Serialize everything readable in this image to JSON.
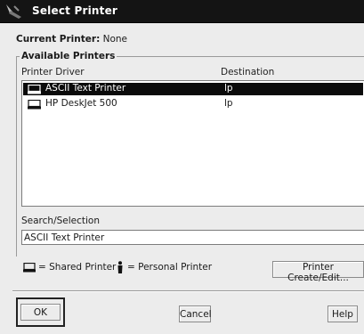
{
  "window": {
    "title": "Select Printer",
    "icon": "printer-icon"
  },
  "current_printer": {
    "label": "Current Printer:",
    "value": "None"
  },
  "available_printers": {
    "legend": "Available Printers",
    "columns": [
      "Printer Driver",
      "Destination"
    ],
    "rows": [
      {
        "name": "ASCII Text Printer",
        "destination": "lp",
        "selected": true,
        "type": "shared"
      },
      {
        "name": "HP DeskJet 500",
        "destination": "lp",
        "selected": false,
        "type": "shared"
      }
    ]
  },
  "search": {
    "label": "Search/Selection",
    "value": "ASCII Text Printer"
  },
  "legend": {
    "shared": "= Shared Printer",
    "personal": "= Personal Printer"
  },
  "buttons": {
    "printer_create": "Printer Create/Edit...",
    "ok": "OK",
    "cancel": "Cancel",
    "help": "Help"
  },
  "colors": {
    "titlebar": "#141414",
    "selection": "#0b0b0b",
    "background": "#ececec"
  }
}
